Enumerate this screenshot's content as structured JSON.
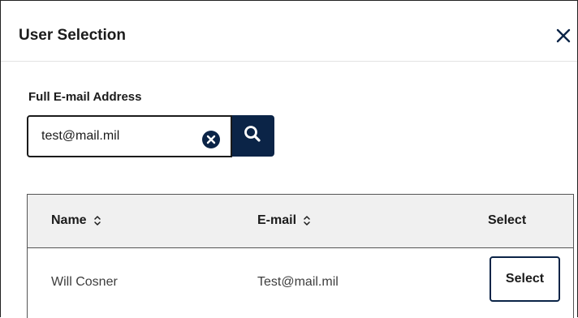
{
  "dialog": {
    "title": "User Selection",
    "close_icon": "close-icon"
  },
  "search": {
    "label": "Full E-mail Address",
    "value": "test@mail.mil",
    "clear_icon": "clear-circle-icon",
    "search_icon": "search-icon",
    "accent_color": "#0b2447"
  },
  "table": {
    "columns": [
      {
        "label": "Name",
        "sortable": true
      },
      {
        "label": "E-mail",
        "sortable": true
      },
      {
        "label": "Select",
        "sortable": false
      }
    ],
    "rows": [
      {
        "name": "Will Cosner",
        "email": "Test@mail.mil",
        "action_label": "Select"
      }
    ]
  }
}
